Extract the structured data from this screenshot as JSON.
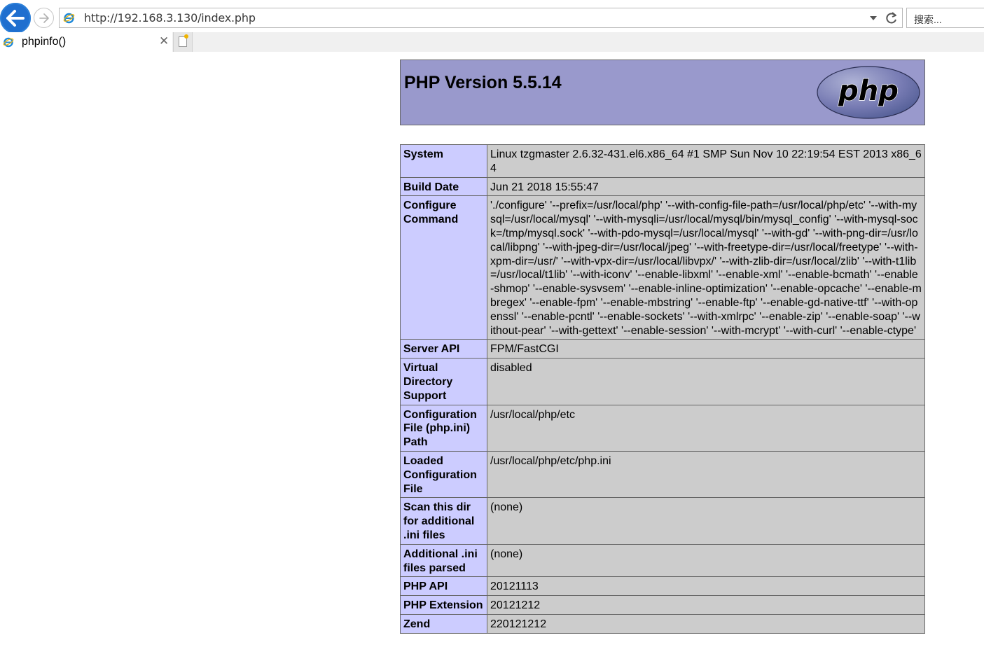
{
  "browser": {
    "url": "http://192.168.3.130/index.php",
    "search_placeholder": "搜索...",
    "tab_title": "phpinfo()"
  },
  "page": {
    "title": "PHP Version 5.5.14",
    "logo_text": "php",
    "rows": [
      {
        "label": "System",
        "value": "Linux tzgmaster 2.6.32-431.el6.x86_64 #1 SMP Sun Nov 10 22:19:54 EST 2013 x86_64"
      },
      {
        "label": "Build Date",
        "value": "Jun 21 2018 15:55:47"
      },
      {
        "label": "Configure Command",
        "value": "'./configure' '--prefix=/usr/local/php' '--with-config-file-path=/usr/local/php/etc' '--with-mysql=/usr/local/mysql' '--with-mysqli=/usr/local/mysql/bin/mysql_config' '--with-mysql-sock=/tmp/mysql.sock' '--with-pdo-mysql=/usr/local/mysql' '--with-gd' '--with-png-dir=/usr/local/libpng' '--with-jpeg-dir=/usr/local/jpeg' '--with-freetype-dir=/usr/local/freetype' '--with-xpm-dir=/usr/' '--with-vpx-dir=/usr/local/libvpx/' '--with-zlib-dir=/usr/local/zlib' '--with-t1lib=/usr/local/t1lib' '--with-iconv' '--enable-libxml' '--enable-xml' '--enable-bcmath' '--enable-shmop' '--enable-sysvsem' '--enable-inline-optimization' '--enable-opcache' '--enable-mbregex' '--enable-fpm' '--enable-mbstring' '--enable-ftp' '--enable-gd-native-ttf' '--with-openssl' '--enable-pcntl' '--enable-sockets' '--with-xmlrpc' '--enable-zip' '--enable-soap' '--without-pear' '--with-gettext' '--enable-session' '--with-mcrypt' '--with-curl' '--enable-ctype'"
      },
      {
        "label": "Server API",
        "value": "FPM/FastCGI"
      },
      {
        "label": "Virtual Directory Support",
        "value": "disabled"
      },
      {
        "label": "Configuration File (php.ini) Path",
        "value": "/usr/local/php/etc"
      },
      {
        "label": "Loaded Configuration File",
        "value": "/usr/local/php/etc/php.ini"
      },
      {
        "label": "Scan this dir for additional .ini files",
        "value": "(none)"
      },
      {
        "label": "Additional .ini files parsed",
        "value": "(none)"
      },
      {
        "label": "PHP API",
        "value": "20121113"
      },
      {
        "label": "PHP Extension",
        "value": "20121212"
      },
      {
        "label": "Zend",
        "value": "220121212"
      }
    ]
  },
  "colors": {
    "header_bg": "#9999cc",
    "label_bg": "#ccccff",
    "value_bg": "#cccccc",
    "back_button": "#1f6fcf"
  },
  "icons": [
    "back-arrow-icon",
    "forward-arrow-icon",
    "ie-page-icon",
    "dropdown-arrow-icon",
    "refresh-icon",
    "close-icon",
    "new-tab-icon"
  ]
}
